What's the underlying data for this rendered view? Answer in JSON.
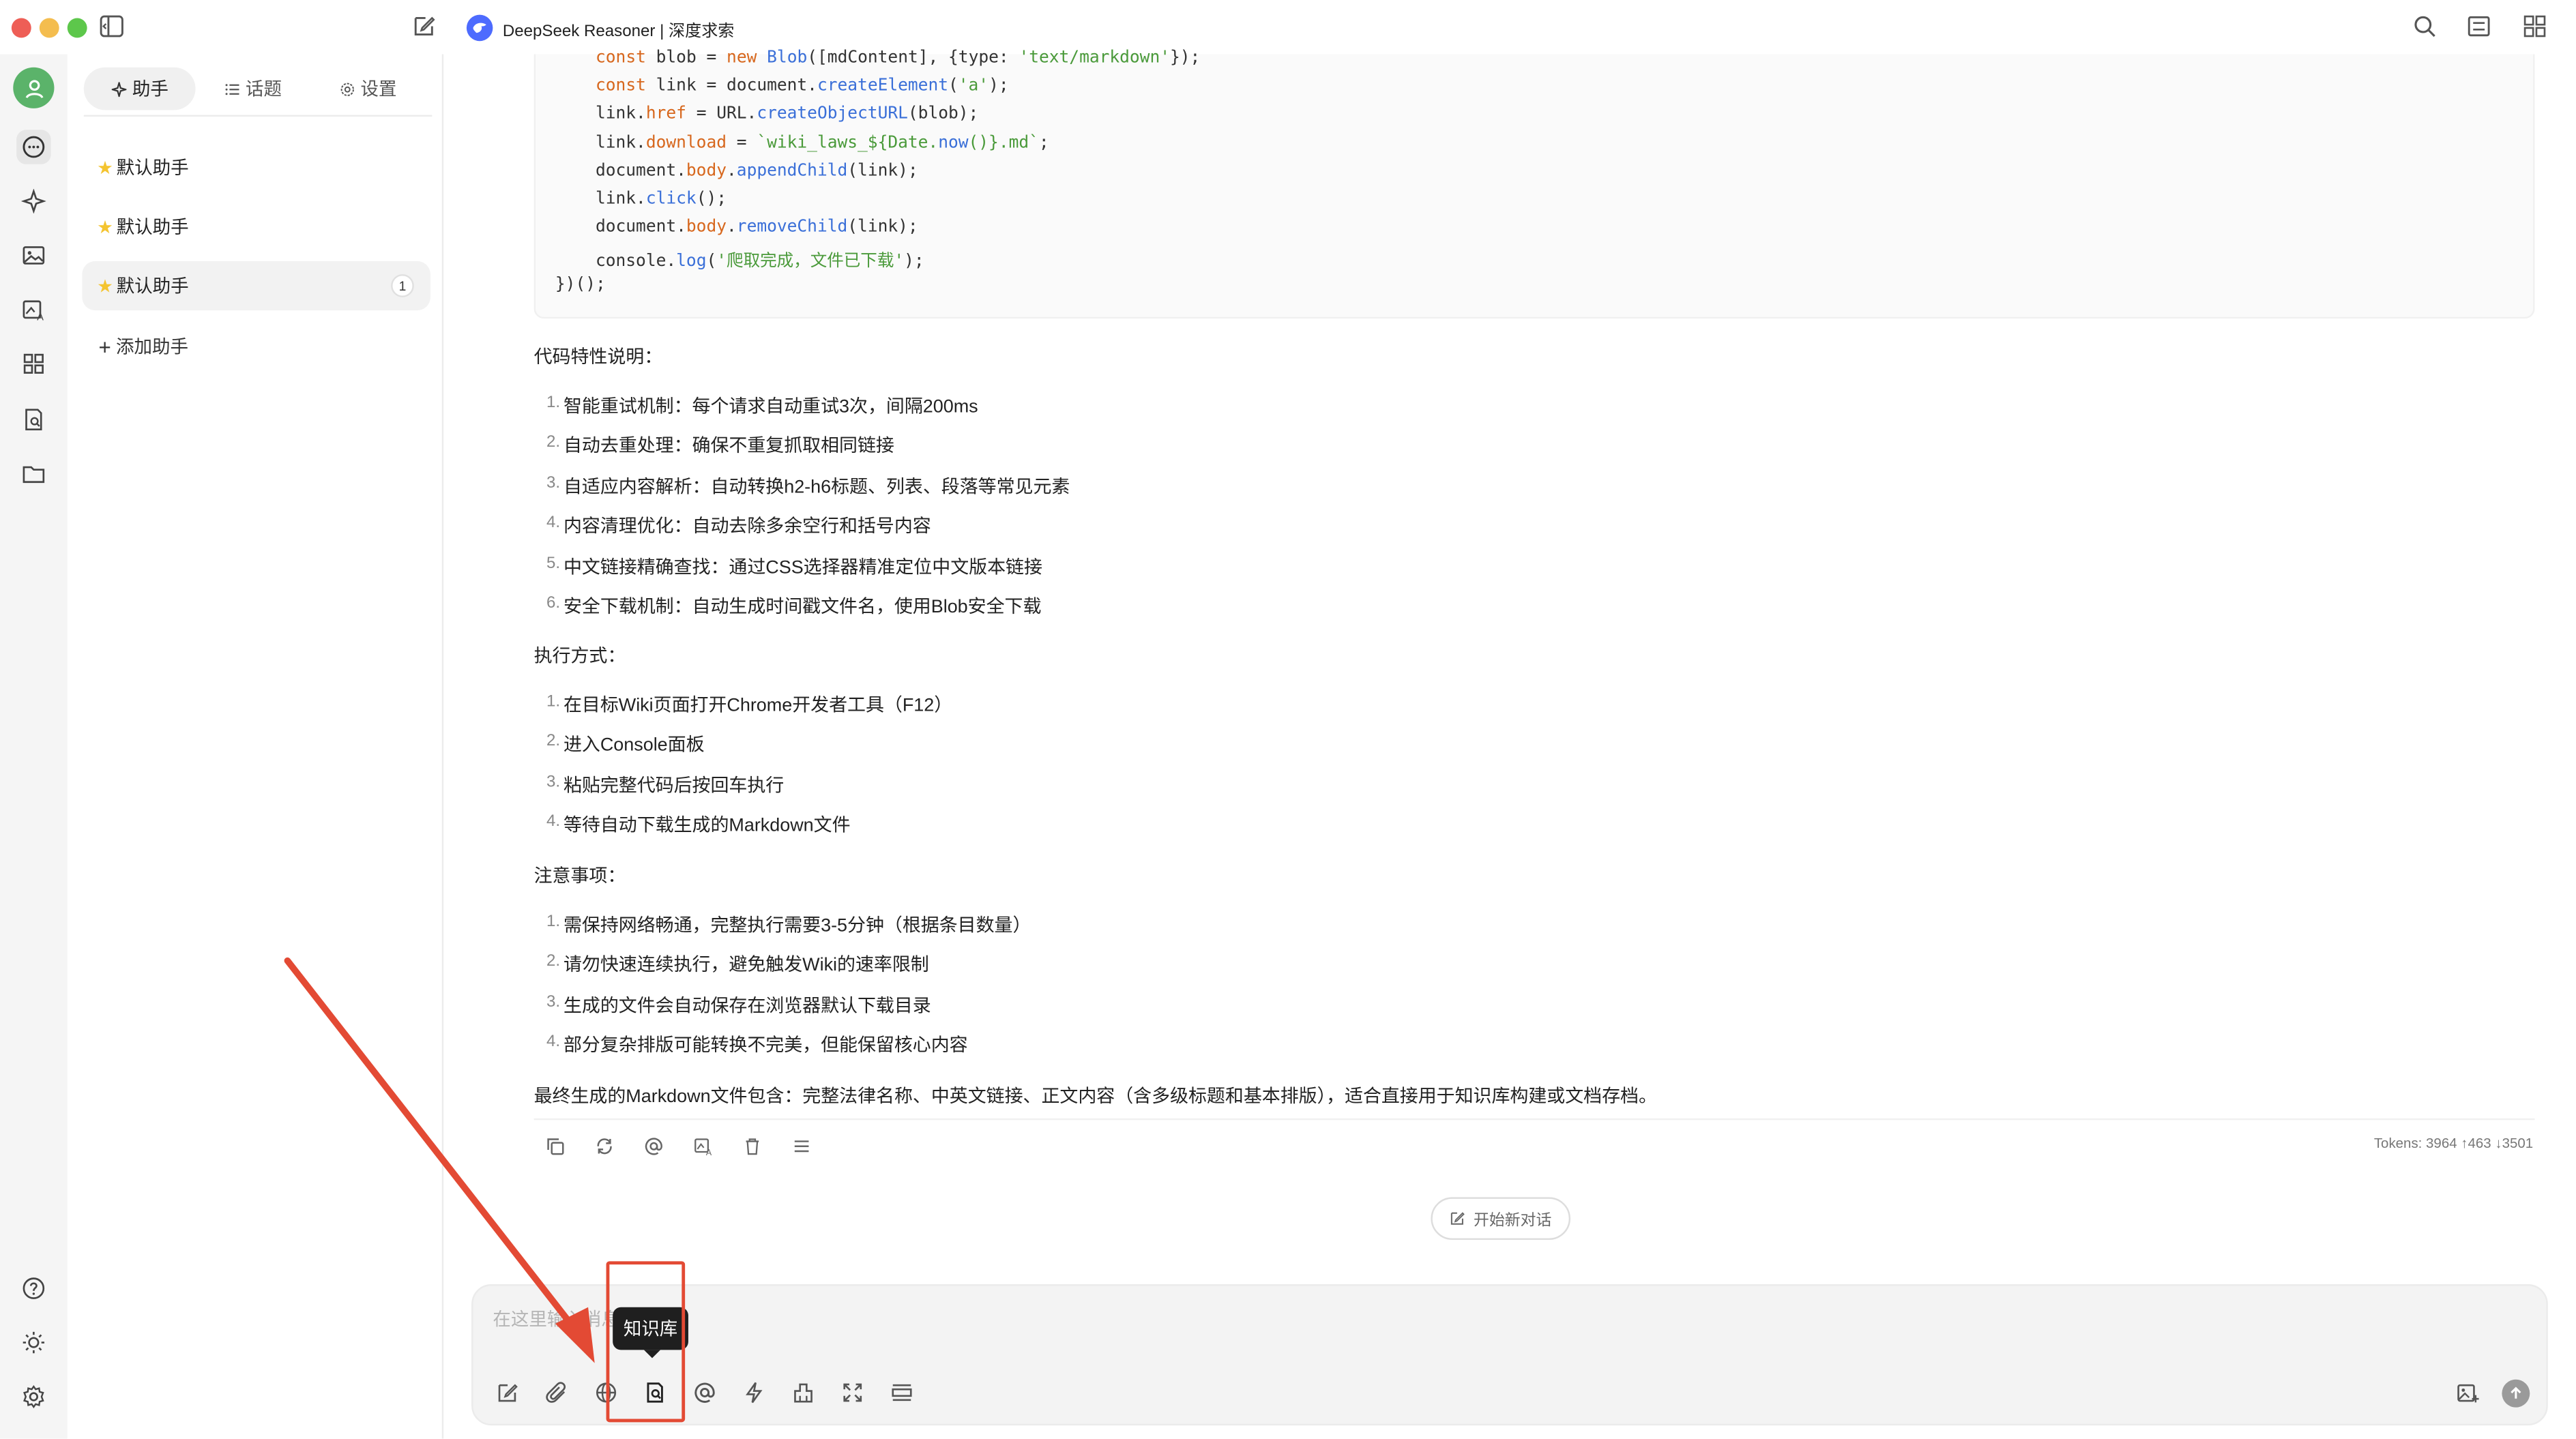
{
  "window": {
    "title": "DeepSeek Reasoner | 深度求索"
  },
  "sidebar": {
    "tabs": [
      {
        "label": "助手",
        "icon": "sparkle-icon"
      },
      {
        "label": "话题",
        "icon": "list-icon"
      },
      {
        "label": "设置",
        "icon": "gear-icon"
      }
    ],
    "assistants": [
      {
        "label": "默认助手",
        "badge": ""
      },
      {
        "label": "默认助手",
        "badge": ""
      },
      {
        "label": "默认助手",
        "badge": "1"
      }
    ],
    "add_label": "添加助手"
  },
  "code": {
    "lines": [
      "    const blob = new Blob([mdContent], {type: 'text/markdown'});",
      "    const link = document.createElement('a');",
      "    link.href = URL.createObjectURL(blob);",
      "    link.download = `wiki_laws_${Date.now()}.md`;",
      "    document.body.appendChild(link);",
      "    link.click();",
      "    document.body.removeChild(link);",
      "    console.log('爬取完成，文件已下载');",
      "})();"
    ]
  },
  "message": {
    "features_heading": "代码特性说明：",
    "features": [
      "智能重试机制：每个请求自动重试3次，间隔200ms",
      "自动去重处理：确保不重复抓取相同链接",
      "自适应内容解析：自动转换h2-h6标题、列表、段落等常见元素",
      "内容清理优化：自动去除多余空行和括号内容",
      "中文链接精确查找：通过CSS选择器精准定位中文版本链接",
      "安全下载机制：自动生成时间戳文件名，使用Blob安全下载"
    ],
    "exec_heading": "执行方式：",
    "exec_steps": [
      "在目标Wiki页面打开Chrome开发者工具（F12）",
      "进入Console面板",
      "粘贴完整代码后按回车执行",
      "等待自动下载生成的Markdown文件"
    ],
    "notes_heading": "注意事项：",
    "notes": [
      "需保持网络畅通，完整执行需要3-5分钟（根据条目数量）",
      "请勿快速连续执行，避免触发Wiki的速率限制",
      "生成的文件会自动保存在浏览器默认下载目录",
      "部分复杂排版可能转换不完美，但能保留核心内容"
    ],
    "summary": "最终生成的Markdown文件包含：完整法律名称、中英文链接、正文内容（含多级标题和基本排版），适合直接用于知识库构建或文档存档。",
    "tokens": "Tokens: 3964 ↑463 ↓3501"
  },
  "new_chat_label": "开始新对话",
  "input": {
    "placeholder": "在这里输入消息",
    "tooltip": "知识库"
  },
  "colors": {
    "accent": "#4d6bfe",
    "annotation": "#e34a34",
    "avatar": "#5bb36a"
  }
}
